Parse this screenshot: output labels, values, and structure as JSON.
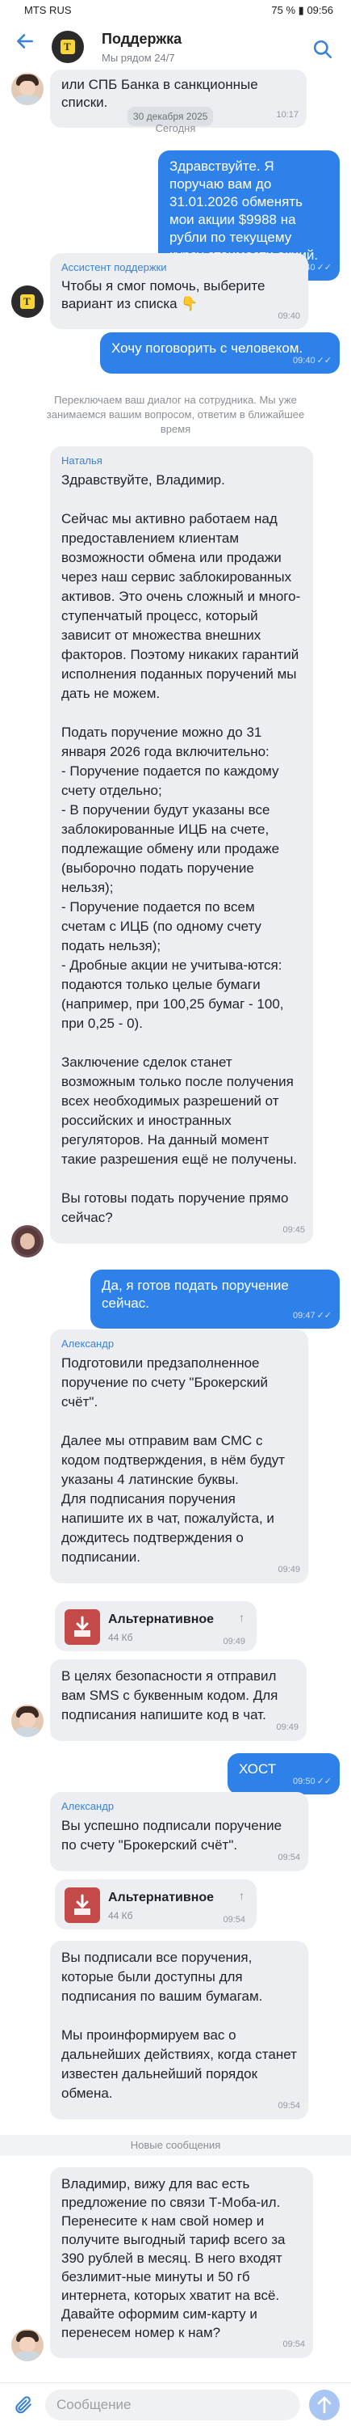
{
  "status_bar": {
    "carrier": "MTS RUS",
    "battery": "75 %",
    "time": "09:56"
  },
  "header": {
    "title": "Поддержка",
    "subtitle": "Мы рядом 24/7"
  },
  "messages": {
    "m0": {
      "text": "или СПБ Банка в санкционные\nсписки.",
      "date": "30 декабря 2025",
      "time": "10:17"
    },
    "today": "Сегодня",
    "m1": {
      "text": "Здравствуйте. Я поручаю вам до 31.01.2026 обменять мои акции $9988 на рубли по текущему курсу стоимости акций.",
      "time": "09:40"
    },
    "m2": {
      "sender": "Ассистент поддержки",
      "text": "Чтобы я смог помочь, выберите вариант из списка 👇",
      "time": "09:40"
    },
    "m3": {
      "text": "Хочу поговорить с человеком.",
      "time": "09:40"
    },
    "notice": "Переключаем ваш диалог на сотрудника. Мы уже занимаемся вашим вопросом, ответим в ближайшее время",
    "m4": {
      "sender": "Наталья",
      "text": "Здравствуйте, Владимир.\n\nСейчас мы активно работаем над предоставлением клиентам возможности обмена или продажи через наш сервис заблокированных активов. Это очень сложный и много-ступенчатый процесс, который зависит от множества внешних факторов. Поэтому никаких гарантий исполнения поданных поручений мы дать не можем.\n\nПодать поручение можно до 31 января 2026 года включительно:\n- Поручение подается по каждому счету отдельно;\n- В поручении будут указаны все заблокированные ИЦБ на счете, подлежащие обмену или продаже (выборочно подать поручение нельзя);\n- Поручение подается по всем счетам с ИЦБ (по одному счету подать нельзя);\n- Дробные акции не учитыва-ются: подаются только целые бумаги (например, при 100,25 бумаг - 100, при 0,25 - 0).\n\nЗаключение сделок станет возможным только после получения всех необходимых разрешений от российских и иностранных регуляторов. На данный момент такие разрешения ещё не получены.\n\nВы готовы подать поручение прямо сейчас?",
      "time": "09:45"
    },
    "m5": {
      "text": "Да, я готов подать поручение сейчас.",
      "time": "09:47"
    },
    "m6": {
      "sender": "Александр",
      "text": "Подготовили предзаполненное поручение по счету \"Брокерский счёт\".\n\nДалее мы отправим вам СМС с кодом подтверждения, в нём будут указаны 4 латинские буквы.\nДля подписания поручения напишите их в чат, пожалуйста, и дождитесь подтверждения о подписании.",
      "time": "09:49"
    },
    "f1": {
      "name": "Альтернативное",
      "more": "↑",
      "size": "44 Кб",
      "time": "09:49"
    },
    "m7": {
      "text": "В целях безопасности я отправил вам SMS с буквенным кодом. Для подписания напишите код в чат.",
      "time": "09:49"
    },
    "m8": {
      "text": "ХОСТ",
      "time": "09:50"
    },
    "m9": {
      "sender": "Александр",
      "text": "Вы успешно подписали поручение по счету \"Брокерский счёт\".",
      "time": "09:54"
    },
    "f2": {
      "name": "Альтернативное",
      "more": "↑",
      "size": "44 Кб",
      "time": "09:54"
    },
    "m10": {
      "text": "Вы подписали все поручения, которые были доступны для подписания по вашим бумагам.\n\nМы проинформируем вас о дальнейших действиях, когда станет известен дальнейший порядок обмена.",
      "time": "09:54"
    },
    "new_divider": "Новые сообщения",
    "m11": {
      "text": "Владимир, вижу для вас есть предложение по связи Т-Моба-ил. Перенесите к нам свой номер и получите выгодный тариф всего за 390 рублей в месяц. В него входят безлимит-ные минуты и 50 гб интернета, которых хватит на всё.\nДавайте оформим сим-карту и перенесем номер к нам?",
      "time": "09:54"
    }
  },
  "input": {
    "placeholder": "Сообщение"
  },
  "colors": {
    "accent": "#2f81ea",
    "incoming": "#eceef1",
    "brand_yellow": "#f7d437"
  }
}
